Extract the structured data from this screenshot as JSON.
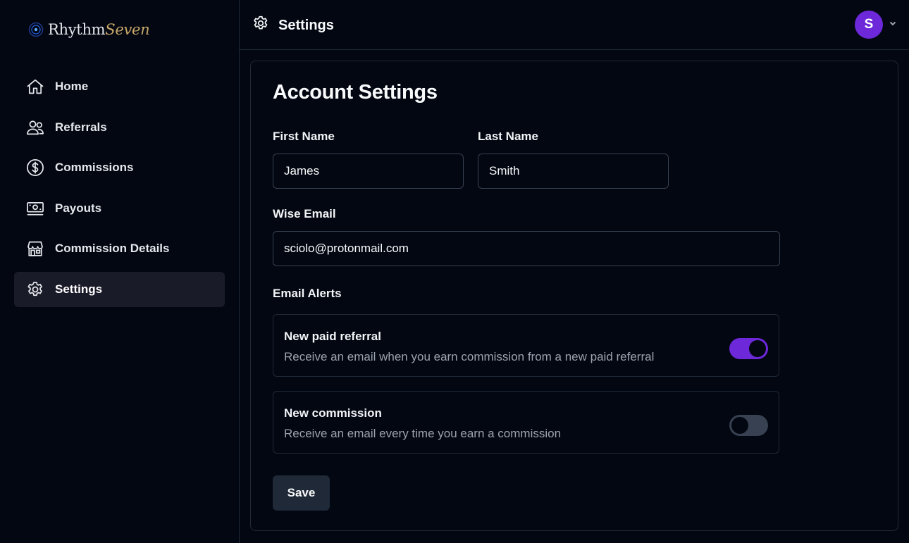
{
  "brand": {
    "name_primary": "Rhythm",
    "name_accent": "Seven"
  },
  "sidebar": {
    "items": [
      {
        "label": "Home",
        "icon": "home-icon",
        "active": false
      },
      {
        "label": "Referrals",
        "icon": "users-icon",
        "active": false
      },
      {
        "label": "Commissions",
        "icon": "dollar-circle-icon",
        "active": false
      },
      {
        "label": "Payouts",
        "icon": "banknotes-icon",
        "active": false
      },
      {
        "label": "Commission Details",
        "icon": "storefront-icon",
        "active": false
      },
      {
        "label": "Settings",
        "icon": "gear-icon",
        "active": true
      }
    ]
  },
  "header": {
    "title": "Settings",
    "icon": "gear-icon",
    "avatar_initial": "S"
  },
  "form": {
    "heading": "Account Settings",
    "first_name_label": "First Name",
    "first_name_value": "James",
    "last_name_label": "Last Name",
    "last_name_value": "Smith",
    "email_label": "Wise Email",
    "email_value": "sciolo@protonmail.com",
    "alerts_label": "Email Alerts",
    "alerts": [
      {
        "title": "New paid referral",
        "description": "Receive an email when you earn commission from a new paid referral",
        "enabled": true
      },
      {
        "title": "New commission",
        "description": "Receive an email every time you earn a commission",
        "enabled": false
      }
    ],
    "save_label": "Save"
  },
  "colors": {
    "accent": "#6d28d9",
    "background": "#030712",
    "border": "#1f2937",
    "active_nav": "#1a1b29",
    "muted_text": "#9ca3af",
    "logo_accent": "#c8a96a"
  }
}
